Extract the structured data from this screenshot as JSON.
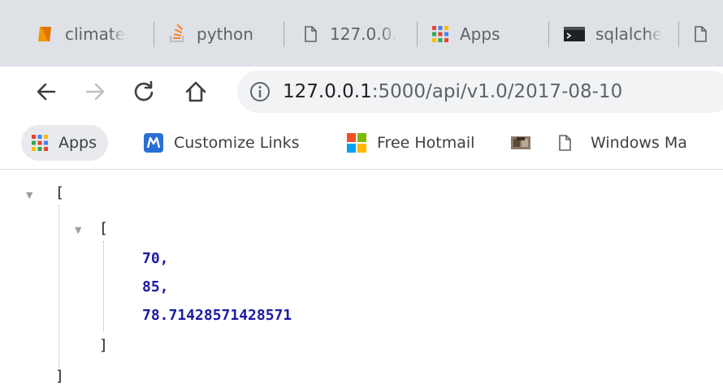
{
  "tabs": [
    {
      "label": "climate",
      "icon": "notebook-orange-icon"
    },
    {
      "label": "python",
      "icon": "stackoverflow-icon"
    },
    {
      "label": "127.0.0.",
      "icon": "page-icon"
    },
    {
      "label": "Apps",
      "icon": "apps-grid-icon"
    },
    {
      "label": "sqlalche",
      "icon": "terminal-icon"
    },
    {
      "label": "",
      "icon": "page-icon"
    }
  ],
  "address": {
    "host": "127.0.0.1",
    "path": ":5000/api/v1.0/2017-08-10"
  },
  "bookmarks": [
    {
      "label": "Apps",
      "icon": "apps-grid-icon"
    },
    {
      "label": "Customize Links",
      "icon": "customize-links-icon"
    },
    {
      "label": "Free Hotmail",
      "icon": "windows-logo-icon"
    },
    {
      "label": "",
      "icon": "image-favicon-icon"
    },
    {
      "label": "Windows Ma",
      "icon": "page-icon"
    }
  ],
  "json_view": {
    "outer_open": "[",
    "inner_open": "[",
    "values": [
      "70,",
      "85,",
      "78.71428571428571"
    ],
    "inner_close": "]",
    "outer_close": "]"
  }
}
